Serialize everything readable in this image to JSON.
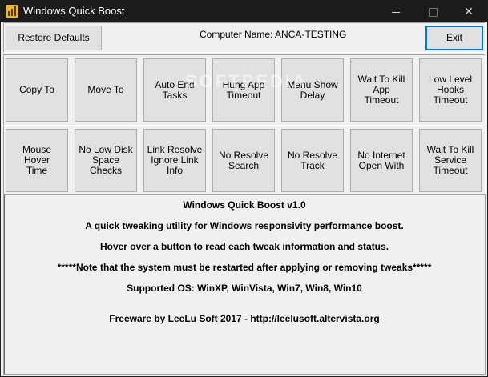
{
  "window": {
    "title": "Windows Quick Boost",
    "controls": {
      "minimize": "",
      "maximize": "",
      "close": "✕"
    }
  },
  "toolbar": {
    "restore_label": "Restore Defaults",
    "computer_name": "Computer Name: ANCA-TESTING",
    "exit_label": "Exit"
  },
  "tweaks_row1": [
    "Copy To",
    "Move To",
    "Auto End Tasks",
    "Hung App\nTimeout",
    "Menu Show\nDelay",
    "Wait To Kill App\nTimeout",
    "Low Level\nHooks Timeout"
  ],
  "tweaks_row2": [
    "Mouse Hover\nTime",
    "No Low Disk\nSpace Checks",
    "Link Resolve\nIgnore Link\nInfo",
    "No Resolve\nSearch",
    "No Resolve\nTrack",
    "No Internet\nOpen With",
    "Wait To Kill\nService\nTimeout"
  ],
  "info": {
    "line1": "Windows Quick Boost v1.0",
    "line2": "A quick tweaking utility for Windows responsivity performance boost.",
    "line3": "Hover over a button to read each tweak information and status.",
    "line4": "*****Note that the system must be restarted after applying or removing tweaks*****",
    "line5": "Supported OS: WinXP, WinVista, Win7, Win8, Win10",
    "line6": "Freeware by LeeLu Soft 2017 - http://leelusoft.altervista.org"
  },
  "watermark": "SOFTPEDIA",
  "colors": {
    "titlebar": "#1c1c1c",
    "focus_border": "#0078d7",
    "button_face": "#e1e1e1"
  }
}
